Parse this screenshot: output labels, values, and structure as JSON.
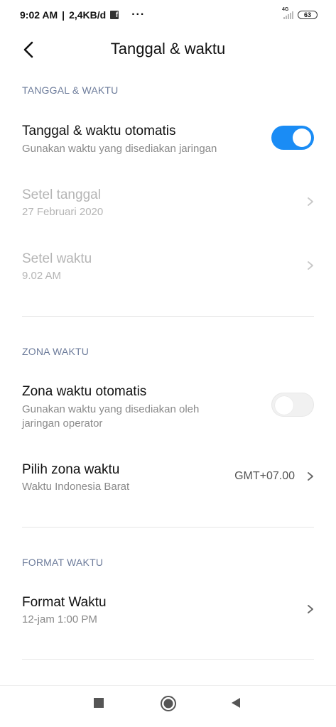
{
  "status_bar": {
    "time": "9:02 AM",
    "speed": "2,4KB/d",
    "more": "···",
    "network_label": "4G",
    "battery": "63"
  },
  "header": {
    "title": "Tanggal & waktu"
  },
  "sections": {
    "date_time": {
      "header": "TANGGAL & WAKTU",
      "auto_title": "Tanggal & waktu otomatis",
      "auto_sub": "Gunakan waktu yang disediakan jaringan",
      "auto_on": true,
      "set_date_title": "Setel tanggal",
      "set_date_value": "27 Februari 2020",
      "set_time_title": "Setel waktu",
      "set_time_value": "9.02 AM"
    },
    "timezone": {
      "header": "ZONA WAKTU",
      "auto_title": "Zona waktu otomatis",
      "auto_sub_line1": "Gunakan waktu yang disediakan oleh",
      "auto_sub_line2": "jaringan operator",
      "auto_on": false,
      "pick_title": "Pilih zona waktu",
      "pick_sub": "Waktu Indonesia Barat",
      "pick_value": "GMT+07.00"
    },
    "format": {
      "header": "FORMAT WAKTU",
      "title": "Format Waktu",
      "sub": "12-jam 1:00 PM"
    }
  },
  "colors": {
    "accent": "#1a8cf5",
    "section_header": "#6d7c9b",
    "disabled": "#b5b5b5"
  }
}
